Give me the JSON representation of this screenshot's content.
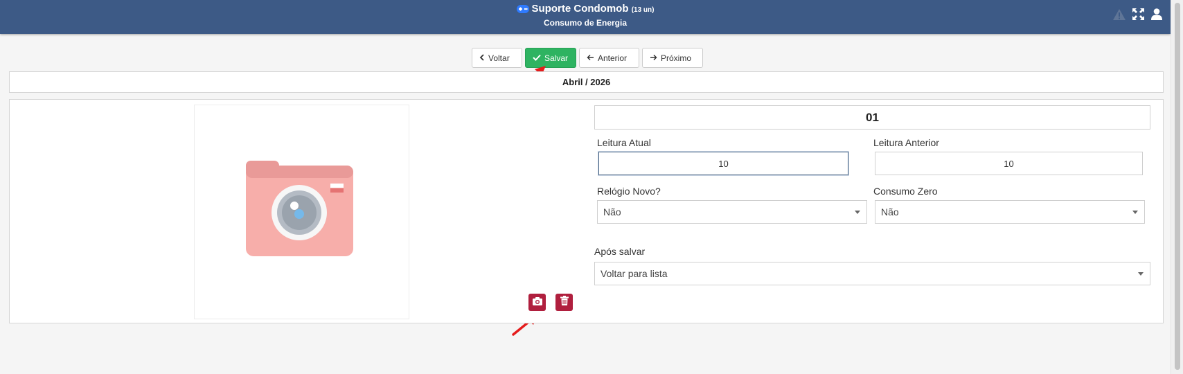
{
  "header": {
    "app_name": "Suporte Condomob",
    "units": "(13 un)",
    "subtitle": "Consumo de Energia",
    "colors": {
      "bar": "#3d5a86"
    },
    "icons": [
      "gamepad-icon",
      "warning-icon",
      "fullscreen-icon",
      "user-icon"
    ]
  },
  "toolbar": {
    "voltar_label": "Voltar",
    "salvar_label": "Salvar",
    "anterior_label": "Anterior",
    "proximo_label": "Próximo",
    "colors": {
      "success": "#2eb361"
    }
  },
  "period": {
    "label": "Abril / 2026"
  },
  "photo": {
    "icon": "camera-placeholder-icon",
    "action_colors": "#b01f3e"
  },
  "form": {
    "unit": "01",
    "leitura_atual_label": "Leitura Atual",
    "leitura_atual_value": "10",
    "leitura_anterior_label": "Leitura Anterior",
    "leitura_anterior_value": "10",
    "relogio_novo_label": "Relógio Novo?",
    "relogio_novo_value": "Não",
    "consumo_zero_label": "Consumo Zero",
    "consumo_zero_value": "Não",
    "apos_salvar_label": "Após salvar",
    "apos_salvar_value": "Voltar para lista"
  }
}
